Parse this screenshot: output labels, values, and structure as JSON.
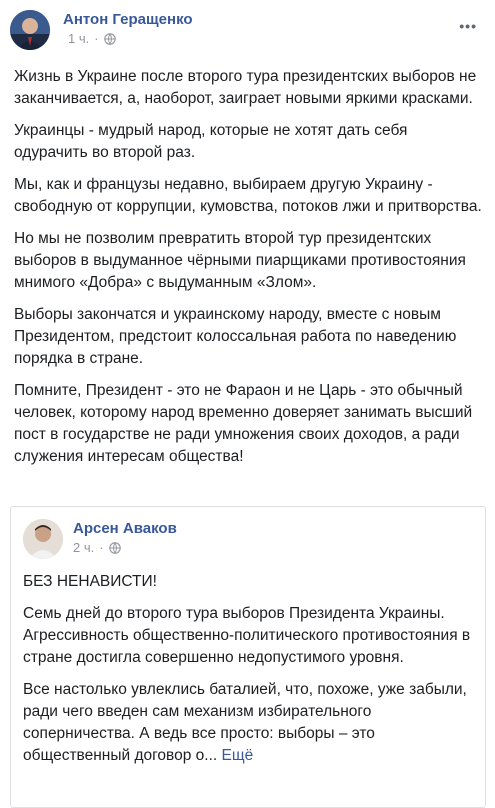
{
  "post": {
    "author": "Антон Геращенко",
    "time": "1 ч.",
    "more_label": "•••",
    "paragraphs": [
      "Жизнь в Украине после второго тура президентских выборов не заканчивается, а, наоборот, заиграет новыми яркими красками.",
      "Украинцы - мудрый народ, которые не хотят дать себя одурачить во второй раз.",
      "Мы, как и французы недавно, выбираем другую Украину - свободную от коррупции, кумовства, потоков лжи и притворства.",
      "Но мы не позволим превратить второй тур президентских выборов в выдуманное чёрными пиарщиками противостояния мнимого «Добра» с выдуманным «Злом».",
      "Выборы закончатся и украинскому народу, вместе с новым Президентом, предстоит колоссальная работа по наведению порядка в стране.",
      "Помните, Президент - это не Фараон и не Царь - это обычный человек, которому народ временно доверяет занимать высший пост в государстве не ради умножения своих доходов, а ради служения интересам общества!"
    ]
  },
  "shared_post": {
    "author": "Арсен Аваков",
    "time": "2 ч.",
    "heading": "БЕЗ НЕНАВИСТИ!",
    "paragraph1": "Семь дней до второго тура выборов Президента Украины.\nАгрессивность общественно-политического противостояния в стране достигла совершенно недопустимого уровня.",
    "paragraph2": "Все настолько увлеклись баталией, что, похоже, уже забыли, ради чего введен сам механизм избирательного соперничества. А ведь все просто: выборы – это общественный договор о...",
    "see_more": "Ещё"
  },
  "icons": {
    "privacy": "globe-icon",
    "menu": "more-icon"
  },
  "colors": {
    "link": "#385898",
    "meta": "#90949c",
    "text": "#1c1e21",
    "border": "#dddfe2"
  }
}
